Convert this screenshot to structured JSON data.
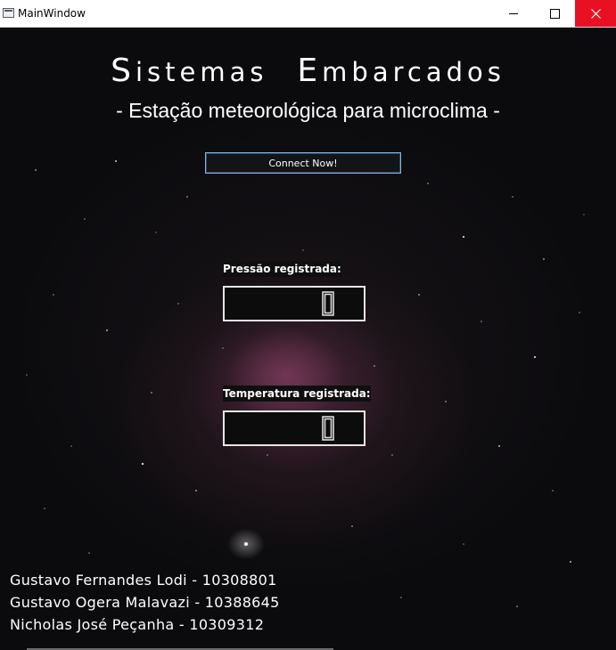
{
  "window": {
    "title": "MainWindow",
    "controls": [
      "minimize-icon",
      "maximize-icon",
      "close-icon"
    ],
    "close_hover_color": "#e81123"
  },
  "header": {
    "title_words": [
      {
        "initial": "S",
        "rest": "istemas"
      },
      {
        "initial": "E",
        "rest": "mbarcados"
      }
    ],
    "subtitle": "- Estação meteorológica para microclima -"
  },
  "connect": {
    "label": "Connect Now!",
    "border_color": "#8ab4da"
  },
  "pressure": {
    "label": "Pressão registrada:",
    "display_value": "0"
  },
  "temperature": {
    "label": "Temperatura registrada:",
    "display_value": "0"
  },
  "credits": [
    "Gustavo Fernandes Lodi - 10308801",
    "Gustavo Ogera Malavazi - 10388645",
    "Nicholas José Peçanha - 10309312"
  ]
}
